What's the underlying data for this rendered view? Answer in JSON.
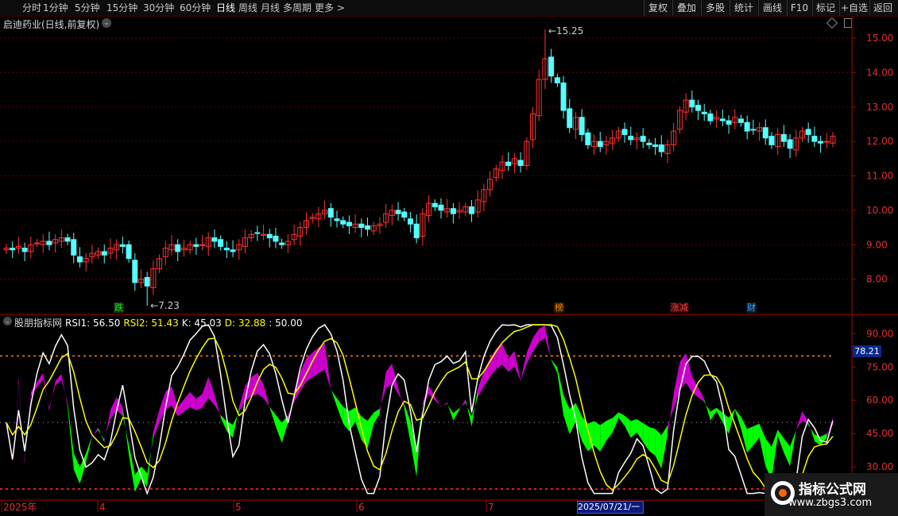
{
  "toolbar": {
    "periods": [
      "分时",
      "1分钟",
      "5分钟",
      "15分钟",
      "30分钟",
      "60分钟",
      "日线",
      "周线",
      "月线",
      "多周期",
      "更多 >"
    ],
    "active": "日线",
    "right": [
      "复权",
      "叠加",
      "多股",
      "统计",
      "画线",
      "F10",
      "标记",
      "+自选",
      "返回"
    ]
  },
  "stock_title": "启迪药业(日线,前复权)",
  "indicator": {
    "name": "股朋指标网",
    "items": [
      {
        "label": "RSI1: 56.50",
        "color": "#ffffff"
      },
      {
        "label": "RSI2: 51.43",
        "color": "#ffff00"
      },
      {
        "label": "K: 45.03",
        "color": "#ffffff"
      },
      {
        "label": "D: 32.88",
        "color": "#ffff00"
      },
      {
        "label": ": 50.00",
        "color": "#ffffff"
      }
    ],
    "last_value": "78.21"
  },
  "price_axis": [
    "15.00",
    "14.00",
    "13.00",
    "12.00",
    "11.00",
    "10.00",
    "9.00",
    "8.00"
  ],
  "ind_axis": [
    "90.00",
    "75.00",
    "60.00",
    "45.00",
    "30.00"
  ],
  "date_axis": [
    "2025年",
    "4",
    "5",
    "6",
    "7"
  ],
  "date_box": "2025/07/21/一",
  "annotations": {
    "high": "15.25",
    "low": "7.23"
  },
  "tags": [
    {
      "text": "跌",
      "color": "#00ff00",
      "bg": "#1a2a1a"
    },
    {
      "text": "榜",
      "color": "#ff8800",
      "bg": "#2a1a00"
    },
    {
      "text": "涨减",
      "color": "#ff4040",
      "bg": "#2a0a0a"
    },
    {
      "text": "财",
      "color": "#44aaff",
      "bg": "#0a1a2a"
    }
  ],
  "watermark": {
    "title": "指标公式网",
    "url": "www.zbgs3.com"
  },
  "colors": {
    "up": "#ff3232",
    "down": "#54ffff",
    "green_fill": "#00ff00",
    "magenta_fill": "#cc00cc",
    "white_line": "#ffffff",
    "yellow_line": "#ffff00"
  },
  "chart_data": {
    "type": "candlestick",
    "close": [
      8.9,
      8.85,
      8.95,
      8.8,
      9.0,
      9.05,
      9.1,
      9.0,
      9.15,
      9.2,
      9.1,
      8.7,
      8.5,
      8.6,
      8.75,
      8.8,
      8.7,
      8.9,
      9.0,
      8.95,
      8.6,
      7.9,
      8.0,
      7.8,
      8.3,
      8.6,
      8.9,
      9.0,
      8.8,
      8.9,
      9.0,
      8.95,
      9.0,
      9.2,
      9.1,
      8.95,
      8.85,
      8.8,
      9.0,
      9.2,
      9.3,
      9.35,
      9.3,
      9.2,
      9.1,
      9.0,
      9.1,
      9.3,
      9.5,
      9.7,
      9.8,
      9.9,
      10.0,
      9.8,
      9.7,
      9.6,
      9.55,
      9.6,
      9.5,
      9.45,
      9.55,
      9.6,
      9.9,
      10.0,
      9.9,
      9.8,
      9.6,
      9.2,
      9.9,
      10.2,
      10.1,
      10.0,
      10.05,
      9.9,
      10.0,
      10.1,
      9.9,
      10.3,
      10.6,
      10.9,
      11.2,
      11.4,
      11.3,
      11.5,
      11.3,
      12.0,
      12.8,
      13.8,
      14.4,
      13.9,
      13.7,
      12.9,
      12.4,
      12.7,
      12.2,
      11.9,
      12.0,
      11.85,
      12.0,
      12.1,
      12.3,
      12.2,
      12.05,
      12.1,
      12.0,
      11.9,
      11.85,
      11.7,
      11.9,
      12.3,
      12.9,
      13.2,
      13.0,
      12.9,
      12.8,
      12.6,
      12.7,
      12.6,
      12.5,
      12.7,
      12.55,
      12.3,
      12.35,
      12.4,
      12.1,
      11.9,
      12.2,
      12.0,
      11.8,
      12.1,
      12.3,
      12.2,
      12.0,
      11.95,
      12.0,
      12.15
    ],
    "ylim": [
      7.0,
      15.6
    ]
  }
}
